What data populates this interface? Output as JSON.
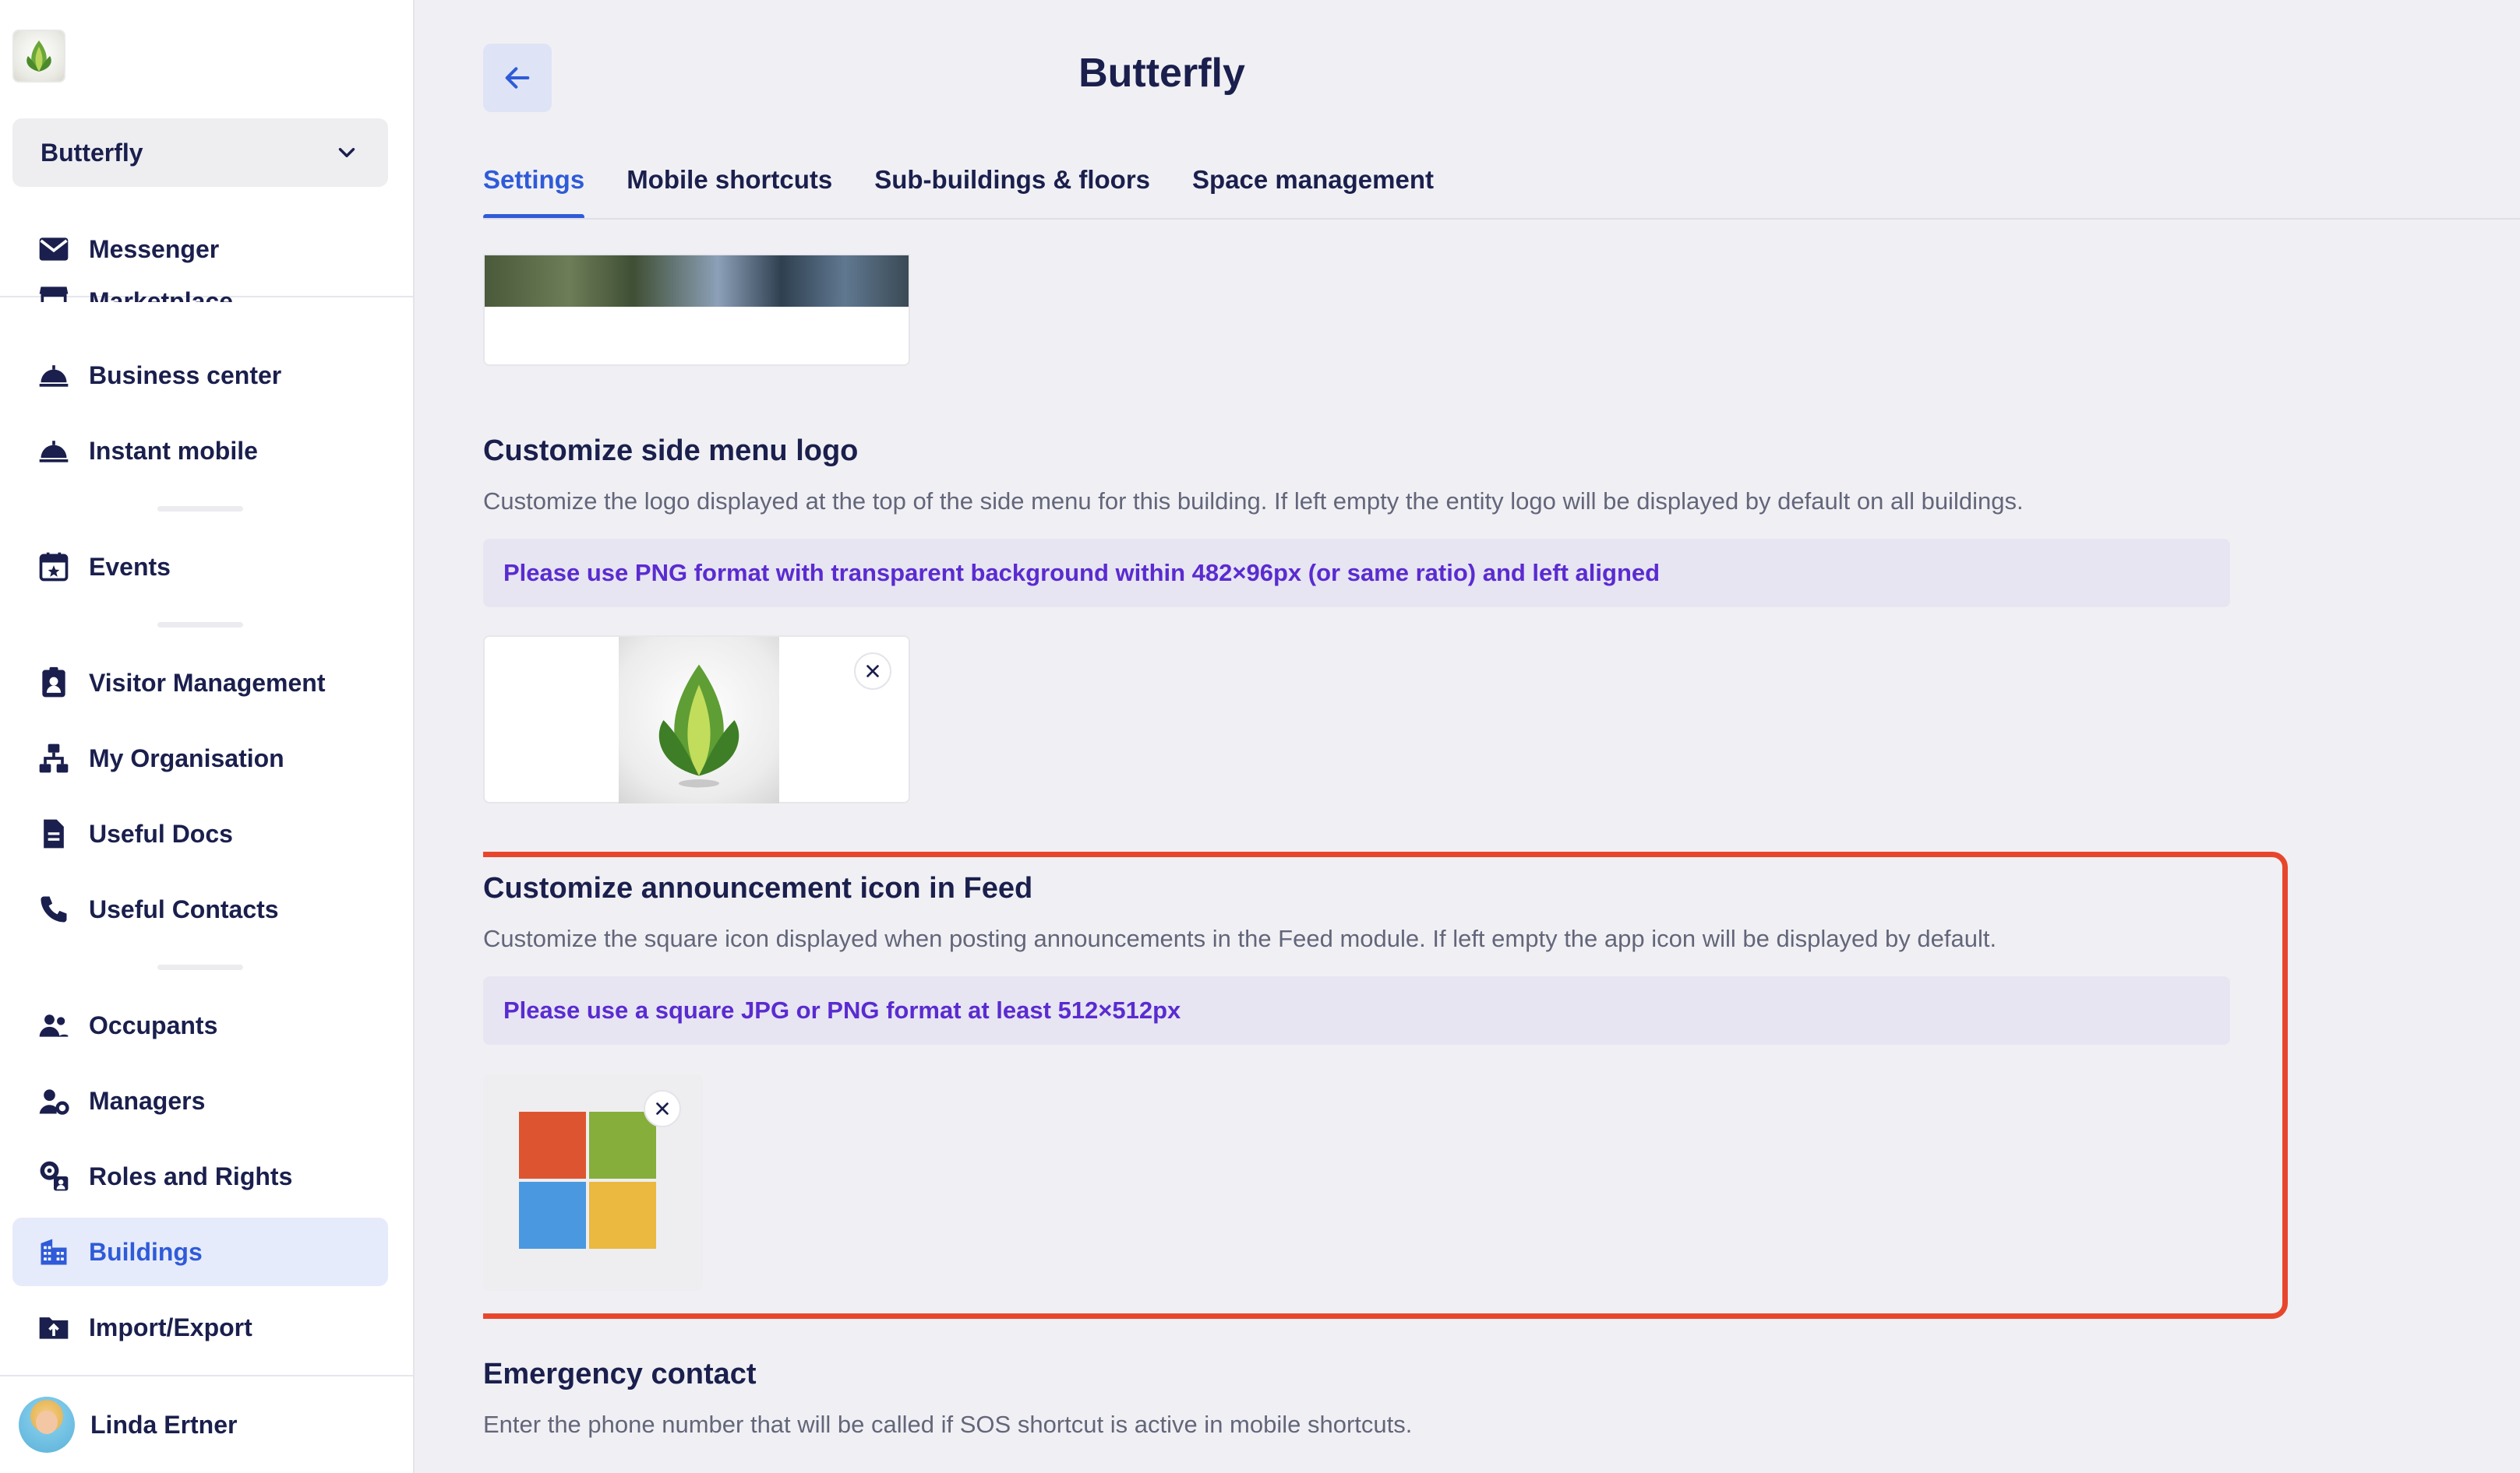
{
  "sidebar": {
    "building_selector": "Butterfly",
    "top_item": {
      "label": "Messenger",
      "icon": "mail-icon"
    },
    "items": [
      {
        "label": "Marketplace",
        "icon": "store-icon"
      },
      {
        "label": "Business center",
        "icon": "cloche-icon"
      },
      {
        "label": "Instant mobile",
        "icon": "cloche-icon"
      },
      {
        "label": "Events",
        "icon": "calendar-star-icon"
      },
      {
        "label": "Visitor Management",
        "icon": "badge-icon"
      },
      {
        "label": "My Organisation",
        "icon": "org-chart-icon"
      },
      {
        "label": "Useful Docs",
        "icon": "document-icon"
      },
      {
        "label": "Useful Contacts",
        "icon": "phone-icon"
      },
      {
        "label": "Occupants",
        "icon": "people-icon"
      },
      {
        "label": "Managers",
        "icon": "user-gear-icon"
      },
      {
        "label": "Roles and Rights",
        "icon": "roles-icon"
      },
      {
        "label": "Buildings",
        "icon": "building-icon"
      },
      {
        "label": "Import/Export",
        "icon": "folder-upload-icon"
      }
    ],
    "user": {
      "name": "Linda Ertner"
    }
  },
  "header": {
    "title": "Butterfly",
    "tabs": [
      {
        "label": "Settings"
      },
      {
        "label": "Mobile shortcuts"
      },
      {
        "label": "Sub-buildings & floors"
      },
      {
        "label": "Space management"
      }
    ]
  },
  "sections": {
    "side_menu_logo": {
      "title": "Customize side menu logo",
      "description": "Customize the logo displayed at the top of the side menu for this building. If left empty the entity logo will be displayed by default on all buildings.",
      "hint": "Please use PNG format with transparent background within 482×96px (or same ratio) and left aligned"
    },
    "announcement_icon": {
      "title": "Customize announcement icon in Feed",
      "description": "Customize the square icon displayed when posting announcements in the Feed module. If left empty the app icon will be displayed by default.",
      "hint": "Please use a square JPG or PNG format at least 512×512px"
    },
    "emergency_contact": {
      "title": "Emergency contact",
      "description": "Enter the phone number that will be called if SOS shortcut is active in mobile shortcuts."
    }
  },
  "colors": {
    "accent": "#2f5bd8",
    "highlight": "#e8462c",
    "hint_text": "#5a2bd0",
    "ms_red": "#dd5530",
    "ms_green": "#85ae3a",
    "ms_blue": "#4a98e0",
    "ms_yellow": "#ebb840"
  }
}
